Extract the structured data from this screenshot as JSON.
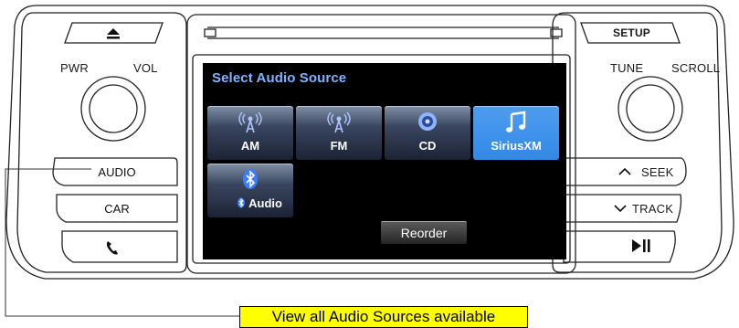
{
  "left_panel": {
    "pwr_label": "PWR",
    "vol_label": "VOL",
    "audio_label": "AUDIO",
    "car_label": "CAR",
    "eject_icon": "eject-icon",
    "phone_icon": "phone-icon"
  },
  "right_panel": {
    "setup_label": "SETUP",
    "tune_label": "TUNE",
    "scroll_label": "SCROLL",
    "seek_label": "SEEK",
    "track_label": "TRACK",
    "seek_icon": "chevron-up-icon",
    "track_icon": "chevron-down-icon",
    "play_pause_icon": "play-pause-icon"
  },
  "screen": {
    "title": "Select Audio Source",
    "sources": [
      {
        "label": "AM",
        "icon": "antenna-icon",
        "selected": false
      },
      {
        "label": "FM",
        "icon": "antenna-icon",
        "selected": false
      },
      {
        "label": "CD",
        "icon": "disc-icon",
        "selected": false
      },
      {
        "label": "SiriusXM",
        "icon": "music-note-icon",
        "selected": true
      },
      {
        "label": "Audio",
        "icon": "bluetooth-icon",
        "selected": false
      }
    ],
    "reorder_label": "Reorder"
  },
  "callout": {
    "text": "View all Audio Sources available"
  },
  "colors": {
    "screen_bg": "#000000",
    "title_color": "#7fb2ff",
    "selected_tile": "#3a8fe8",
    "callout_bg": "#ffff00"
  }
}
